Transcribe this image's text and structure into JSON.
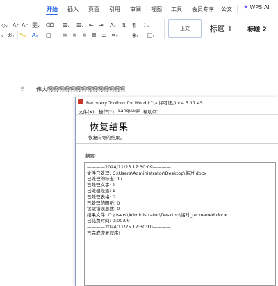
{
  "ribbon": {
    "tabs": [
      "开始",
      "插入",
      "页面",
      "引用",
      "审阅",
      "视图",
      "工具",
      "会员专享",
      "公文"
    ],
    "active_tab": "开始",
    "wps_ai": "WPS AI",
    "styles": {
      "normal": "正文",
      "heading1": "标题 1",
      "heading2": "标题 2"
    },
    "accent_color": "#2b66e8"
  },
  "document": {
    "text": "伟大啊啊啊啊啊啊啊啊啊啊啊啊啊啊"
  },
  "recovery_window": {
    "title": "Recovery Toolbox for Word (个人许可证。) v.4.5.17.45",
    "menu": [
      "文件(X)",
      "操作(Y)",
      "Language",
      "帮助(Z)"
    ],
    "header_title": "恢复结果",
    "header_subtitle": "恢复向导的结果。",
    "summary_label": "摘要:",
    "log_lines": [
      "————2024/11/25 17:30:09————",
      "文件已处理:  C:\\Users\\Administrator\\Desktop\\临时.docx",
      "已处理的标志: 17",
      "已处理文字:  1",
      "已处理段落:  1",
      "已处理表格:  0",
      "已处理的图纸: 0",
      "读取错误总数: 0",
      "结果文件:  C:\\Users\\Administrator\\Desktop\\临时_recovered.docx",
      "已花费时间: 0:00:00",
      "————2024/11/25 17:30:10————",
      "已完成恢复程序!"
    ]
  }
}
